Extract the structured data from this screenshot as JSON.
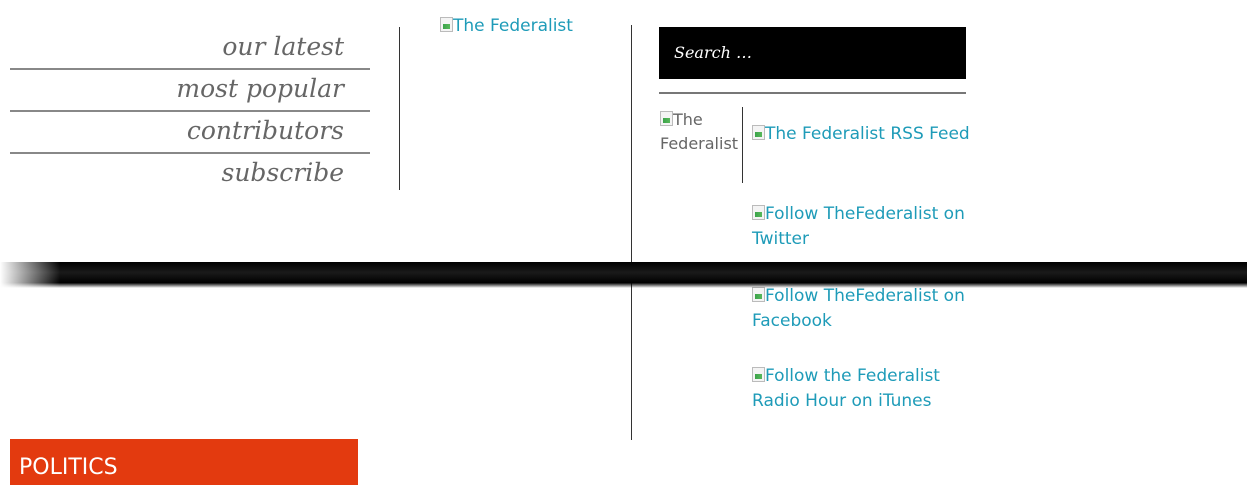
{
  "nav": {
    "items": [
      {
        "label": "our latest"
      },
      {
        "label": "most popular"
      },
      {
        "label": "contributors"
      },
      {
        "label": "subscribe"
      }
    ]
  },
  "header": {
    "logo_alt": "The Federalist"
  },
  "search": {
    "placeholder": "Search …"
  },
  "sidebar": {
    "logo_small_alt": "The Federalist",
    "social": [
      {
        "label": "The Federalist RSS Feed"
      },
      {
        "label": "Follow TheFederalist on Twitter"
      },
      {
        "label": "Follow TheFederalist on Facebook"
      },
      {
        "label": "Follow the Federalist Radio Hour on iTunes"
      }
    ]
  },
  "section": {
    "label": "POLITICS"
  },
  "colors": {
    "link": "#1e9bb8",
    "section_bg": "#e33a0f",
    "search_bg": "#000000"
  }
}
